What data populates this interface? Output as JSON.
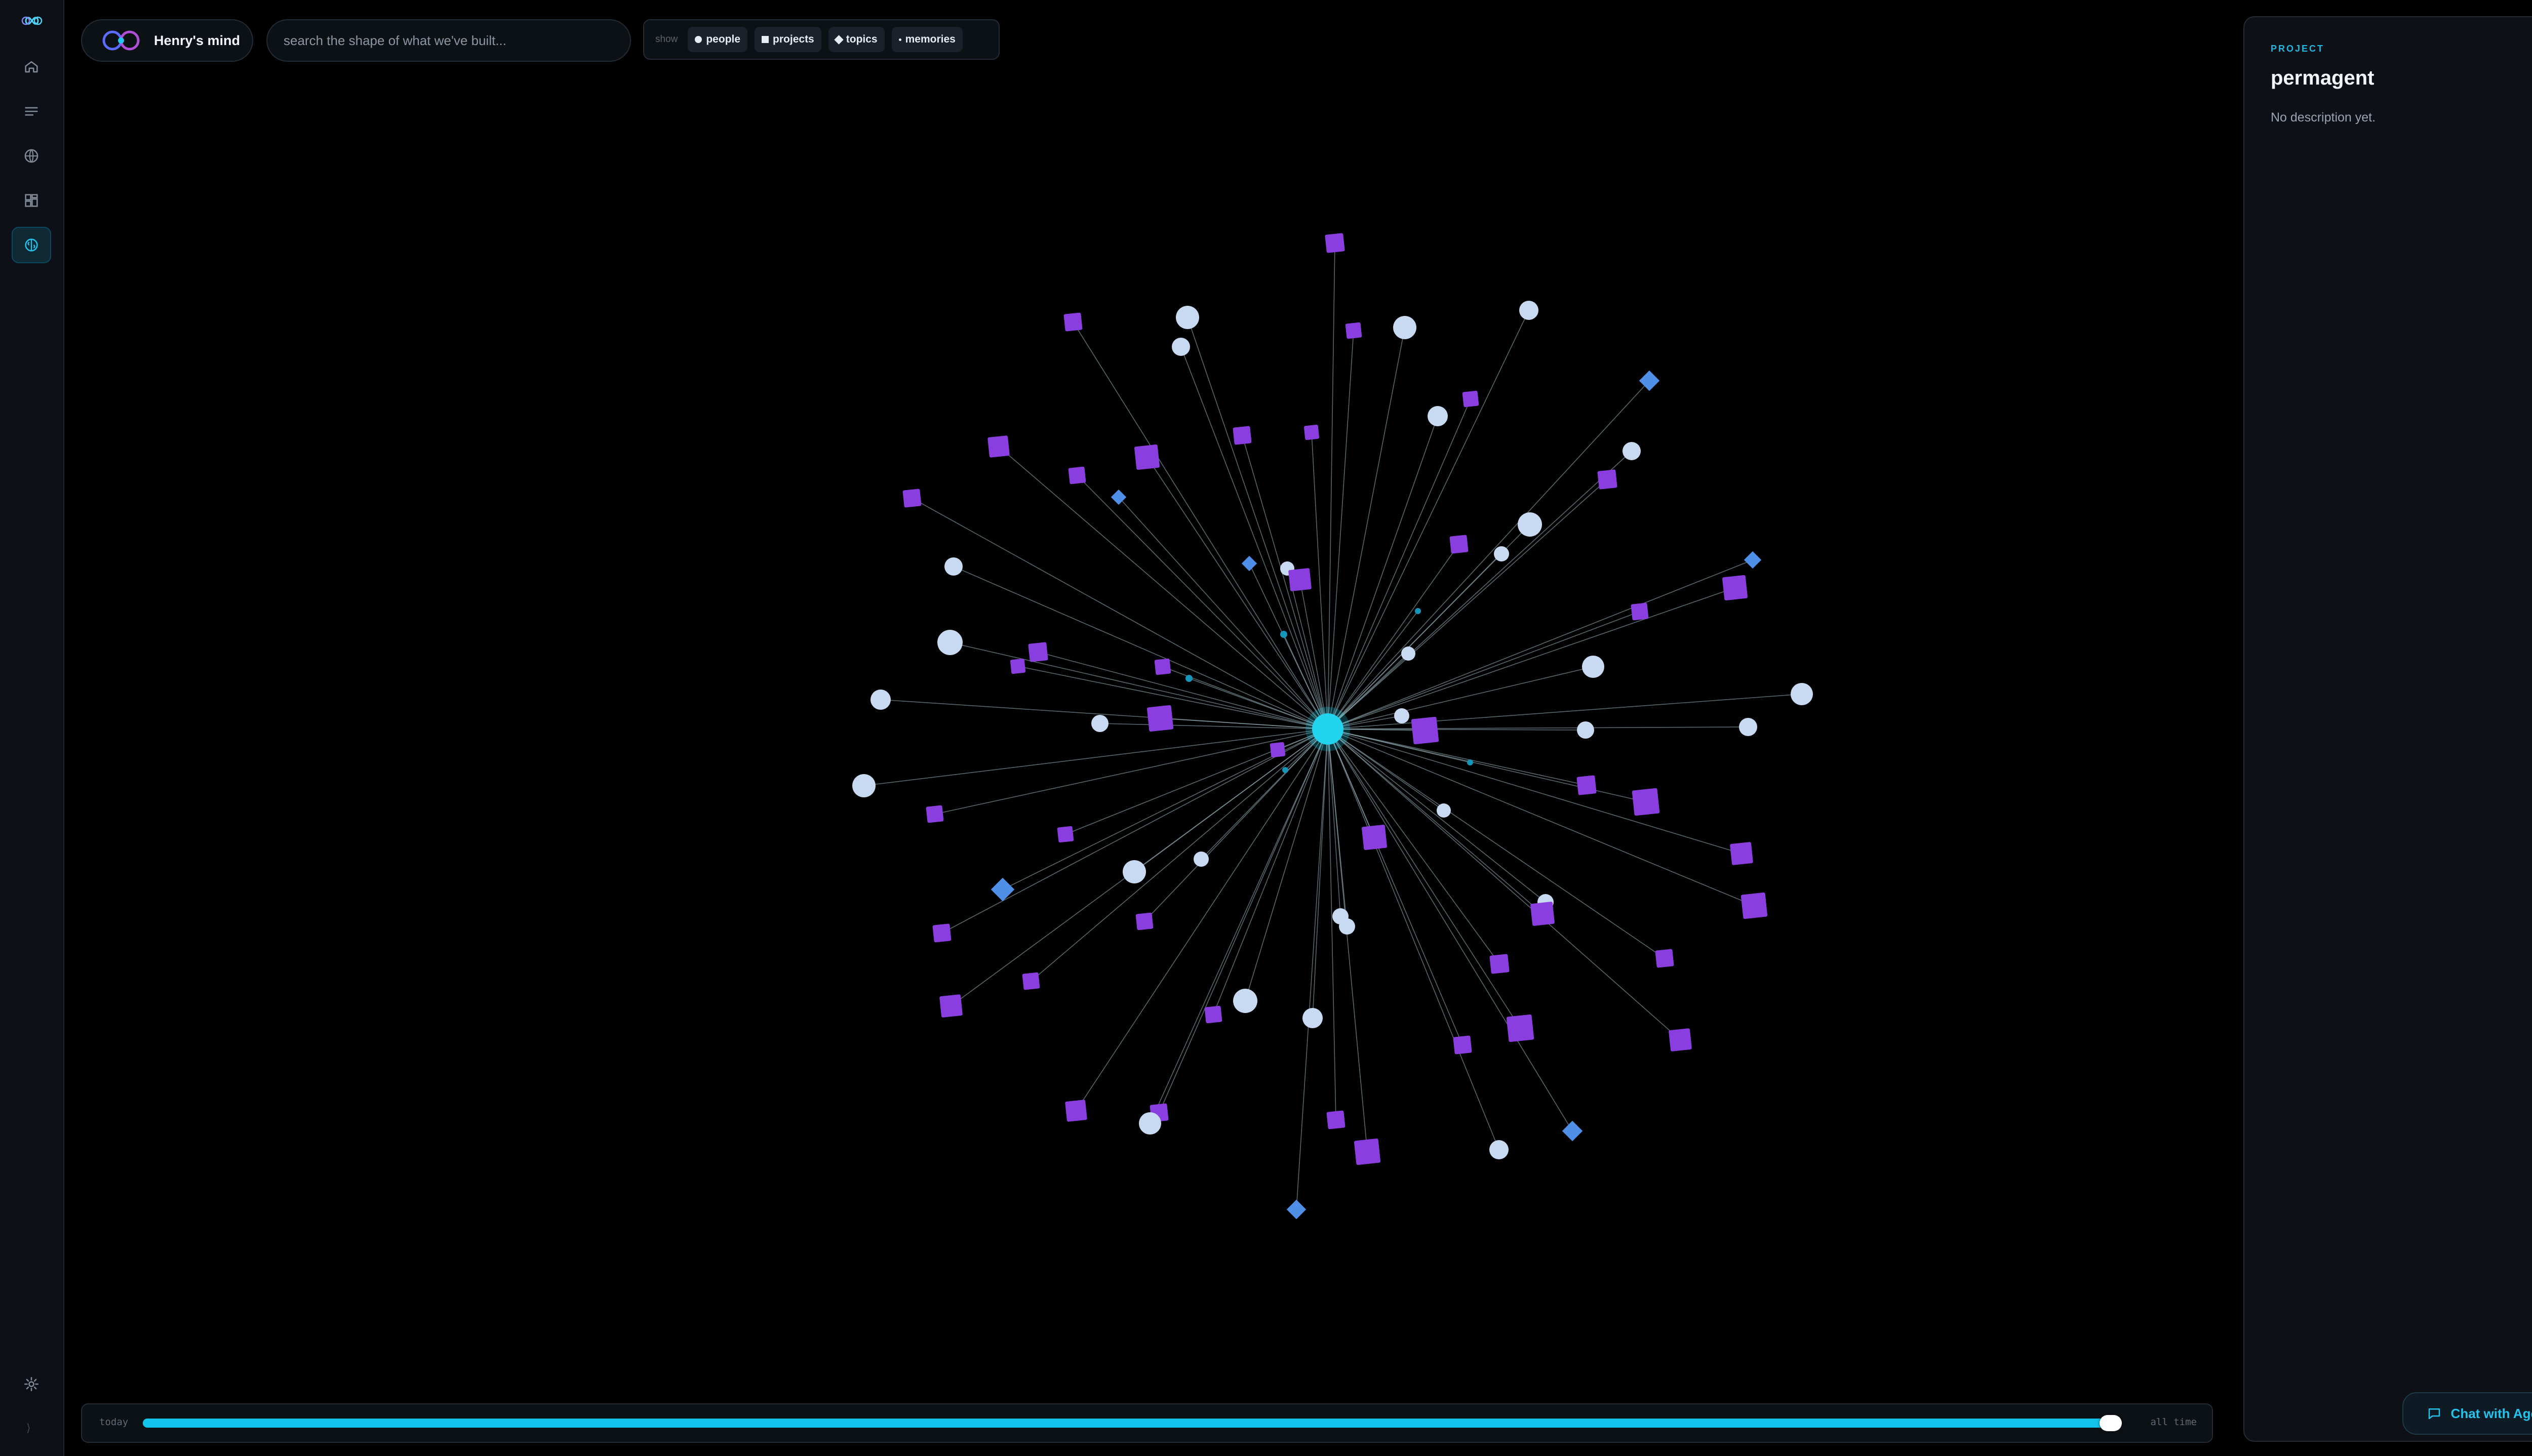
{
  "brand": {
    "name": "Henry's mind"
  },
  "search": {
    "placeholder": "search the shape of what we've built..."
  },
  "filters": {
    "label": "show",
    "chips": [
      {
        "label": "people",
        "marker": "circle"
      },
      {
        "label": "projects",
        "marker": "square"
      },
      {
        "label": "topics",
        "marker": "diamond"
      },
      {
        "label": "memories",
        "marker": "small-dot"
      }
    ]
  },
  "sidebar": {
    "items": [
      {
        "name": "home",
        "icon": "home-icon",
        "active": false
      },
      {
        "name": "feed",
        "icon": "list-icon",
        "active": false
      },
      {
        "name": "world",
        "icon": "globe-icon",
        "active": false
      },
      {
        "name": "grid",
        "icon": "grid-icon",
        "active": false
      },
      {
        "name": "mind",
        "icon": "brain-icon",
        "active": true
      }
    ],
    "footer": [
      {
        "name": "settings",
        "icon": "gear-icon"
      },
      {
        "name": "collapse",
        "icon": "chevron-right-icon"
      }
    ]
  },
  "timeline": {
    "start_label": "today",
    "end_label": "all time",
    "value_fraction": 1.0
  },
  "panel": {
    "kind": "PROJECT",
    "title": "permagent",
    "description": "No description yet.",
    "chat_label": "Chat with Agent"
  },
  "graph": {
    "colors": {
      "center": "#22d3ee",
      "person": "#c8d9f2",
      "project": "#8b3ee0",
      "topic": "#4f8fe8",
      "memory": "#1596b8",
      "edge": "#9fbcc4"
    }
  }
}
